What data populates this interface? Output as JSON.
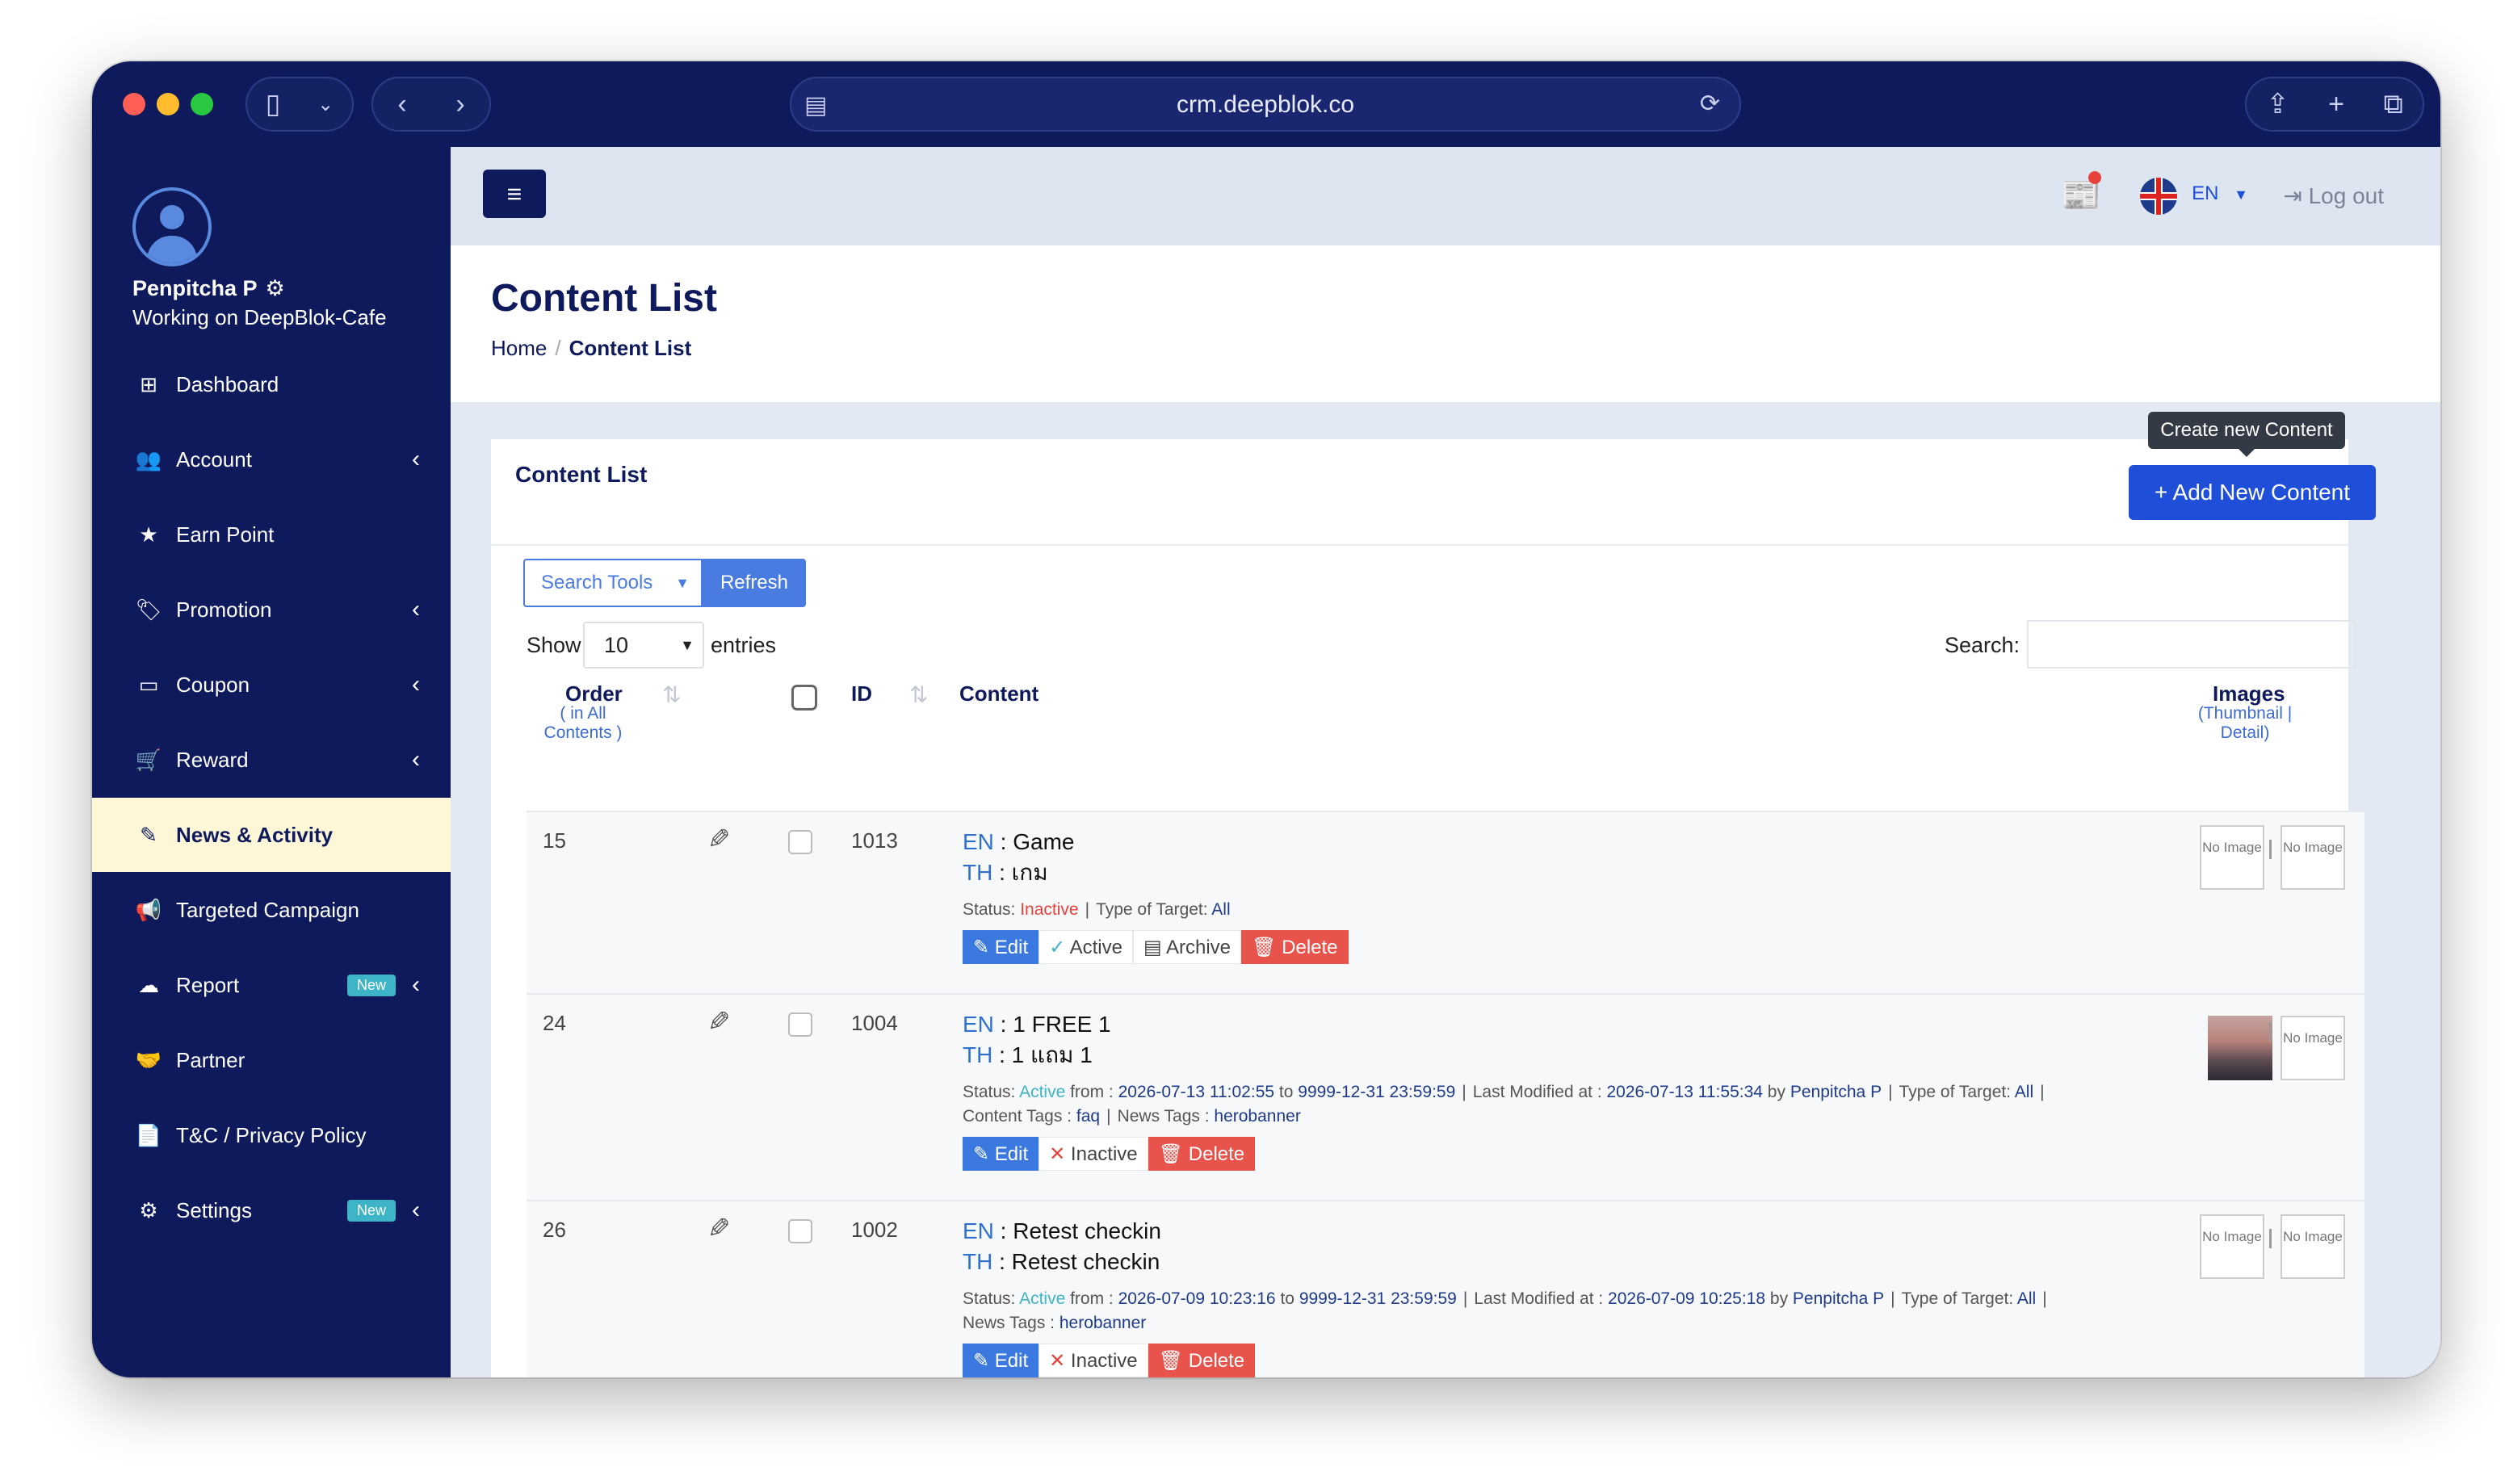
{
  "browser": {
    "url": "crm.deepblok.co"
  },
  "sidebar": {
    "user": {
      "name": "Penpitcha P",
      "working": "Working on DeepBlok-Cafe"
    },
    "items": [
      {
        "label": "Dashboard",
        "icon": "grid-icon"
      },
      {
        "label": "Account",
        "icon": "users-icon",
        "arrow": "‹"
      },
      {
        "label": "Earn Point",
        "icon": "star-icon"
      },
      {
        "label": "Promotion",
        "icon": "tag-icon",
        "arrow": "‹"
      },
      {
        "label": "Coupon",
        "icon": "ticket-icon",
        "arrow": "‹"
      },
      {
        "label": "Reward",
        "icon": "cart-icon",
        "arrow": "‹"
      },
      {
        "label": "News & Activity",
        "icon": "edit-icon"
      },
      {
        "label": "Targeted Campaign",
        "icon": "megaphone-icon"
      },
      {
        "label": "Report",
        "icon": "cloud-icon",
        "badge": "New",
        "arrow": "‹"
      },
      {
        "label": "Partner",
        "icon": "handshake-icon"
      },
      {
        "label": "T&C / Privacy Policy",
        "icon": "file-icon"
      },
      {
        "label": "Settings",
        "icon": "gear-icon",
        "badge": "New",
        "arrow": "‹"
      }
    ]
  },
  "header": {
    "lang": "EN",
    "logout": "Log out"
  },
  "page": {
    "title": "Content List",
    "breadcrumb": {
      "home": "Home",
      "current": "Content List"
    }
  },
  "card": {
    "title": "Content List",
    "tooltip": "Create new Content",
    "add_button": "+ Add New Content",
    "search_tools": "Search Tools",
    "refresh": "Refresh",
    "show": "Show",
    "entries_value": "10",
    "entries": "entries",
    "search_label": "Search:",
    "columns": {
      "order": "Order",
      "order_sub1": "( in All",
      "order_sub2": "Contents )",
      "id": "ID",
      "content": "Content",
      "images": "Images",
      "images_sub1": "(Thumbnail |",
      "images_sub2": "Detail)"
    }
  },
  "rows": [
    {
      "order": "15",
      "id": "1013",
      "en": "Game",
      "th": "เกม",
      "status_label": "Status:",
      "status": "Inactive",
      "target_label": "Type of Target:",
      "target": "All",
      "buttons": {
        "edit": "Edit",
        "active": "Active",
        "archive": "Archive",
        "delete": "Delete"
      },
      "thumb": "No Image",
      "detail": "No Image"
    },
    {
      "order": "24",
      "id": "1004",
      "en": "1 FREE 1",
      "th": "1 แถม 1",
      "status_label": "Status:",
      "status": "Active",
      "from_label": "from :",
      "from": "2026-07-13 11:02:55",
      "to_label": "to",
      "to": "9999-12-31 23:59:59",
      "modified_label": "Last Modified at :",
      "modified": "2026-07-13 11:55:34",
      "by_label": "by",
      "by": "Penpitcha P",
      "target_label": "Type of Target:",
      "target": "All",
      "ctags_label": "Content Tags :",
      "ctags": "faq",
      "ntags_label": "News Tags :",
      "ntags": "herobanner",
      "buttons": {
        "edit": "Edit",
        "inactive": "Inactive",
        "delete": "Delete"
      },
      "detail": "No Image"
    },
    {
      "order": "26",
      "id": "1002",
      "en": "Retest checkin",
      "th": "Retest checkin",
      "status_label": "Status:",
      "status": "Active",
      "from_label": "from :",
      "from": "2026-07-09 10:23:16",
      "to_label": "to",
      "to": "9999-12-31 23:59:59",
      "modified_label": "Last Modified at :",
      "modified": "2026-07-09 10:25:18",
      "by_label": "by",
      "by": "Penpitcha P",
      "target_label": "Type of Target:",
      "target": "All",
      "ntags_label": "News Tags :",
      "ntags": "herobanner",
      "buttons": {
        "edit": "Edit",
        "inactive": "Inactive",
        "delete": "Delete"
      },
      "thumb": "No Image",
      "detail": "No Image"
    }
  ],
  "lang_keys": {
    "en": "EN",
    "th": "TH"
  },
  "colors": {
    "sidebar": "#0e1a5c",
    "accent": "#1f4fd8",
    "active": "#3eb5c7",
    "inactive": "#e8413c",
    "delete": "#e8534c"
  }
}
